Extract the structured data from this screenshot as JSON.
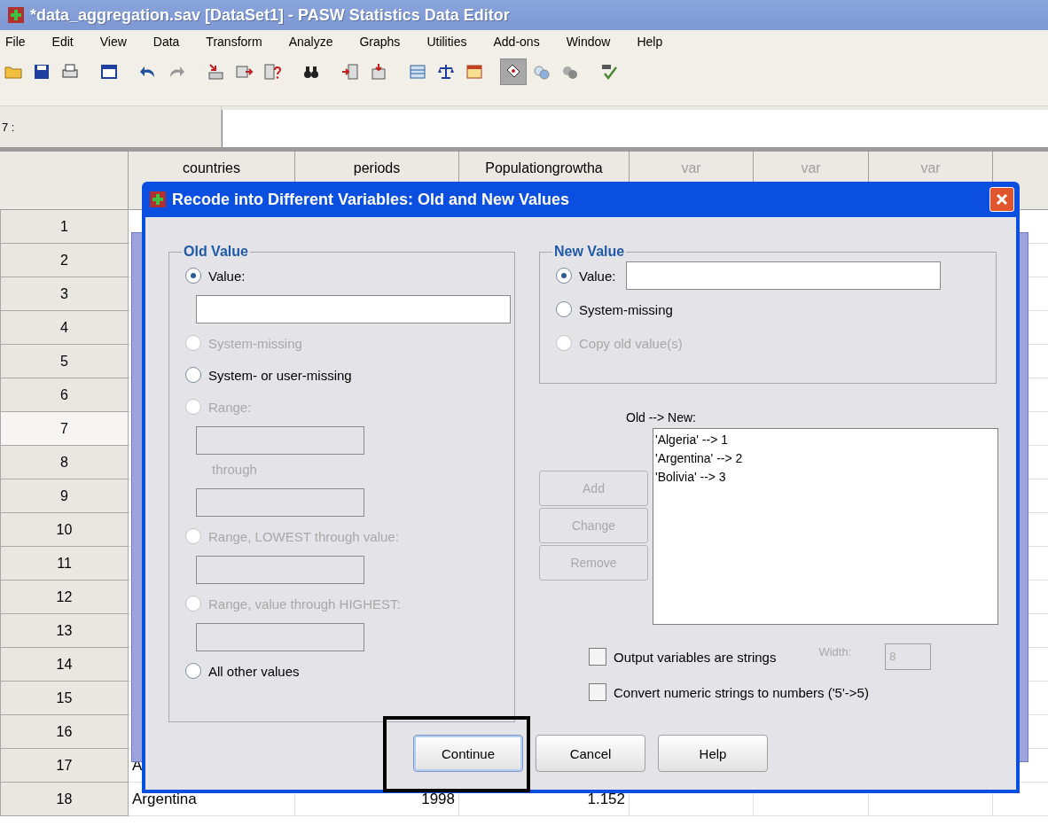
{
  "window": {
    "title": "*data_aggregation.sav [DataSet1] - PASW Statistics Data Editor"
  },
  "menu": [
    "File",
    "Edit",
    "View",
    "Data",
    "Transform",
    "Analyze",
    "Graphs",
    "Utilities",
    "Add-ons",
    "Window",
    "Help"
  ],
  "toolbar": [
    [
      {
        "pressed": false
      },
      {
        "pressed": false
      },
      {
        "pressed": false
      }
    ],
    [
      {
        "pressed": false
      }
    ],
    [
      {
        "pressed": false
      },
      {
        "pressed": false
      }
    ],
    [
      {
        "pressed": false
      },
      {
        "pressed": false
      },
      {
        "pressed": false
      }
    ],
    [
      {
        "pressed": false
      }
    ],
    [
      {
        "pressed": false
      },
      {
        "pressed": false
      }
    ],
    [
      {
        "pressed": false
      },
      {
        "pressed": false
      },
      {
        "pressed": false
      }
    ],
    [
      {
        "pressed": true
      },
      {
        "pressed": false
      },
      {
        "pressed": false
      }
    ],
    [
      {
        "pressed": false
      }
    ]
  ],
  "cell_editor": {
    "reference": "7 :"
  },
  "grid": {
    "columns": [
      {
        "name": "countries",
        "kind": "variable"
      },
      {
        "name": "periods",
        "kind": "variable"
      },
      {
        "name": "Populationgrowtha",
        "kind": "variable"
      },
      {
        "name": "var",
        "kind": "empty"
      },
      {
        "name": "var",
        "kind": "empty"
      },
      {
        "name": "var",
        "kind": "empty"
      }
    ],
    "rows": [
      {
        "number": "1",
        "cells": []
      },
      {
        "number": "2",
        "cells": []
      },
      {
        "number": "3",
        "cells": []
      },
      {
        "number": "4",
        "cells": []
      },
      {
        "number": "5",
        "cells": []
      },
      {
        "number": "6",
        "cells": []
      },
      {
        "number": "7",
        "cells": [],
        "selected": true
      },
      {
        "number": "8",
        "cells": []
      },
      {
        "number": "9",
        "cells": []
      },
      {
        "number": "10",
        "cells": []
      },
      {
        "number": "11",
        "cells": []
      },
      {
        "number": "12",
        "cells": []
      },
      {
        "number": "13",
        "cells": []
      },
      {
        "number": "14",
        "cells": []
      },
      {
        "number": "15",
        "cells": []
      },
      {
        "number": "16",
        "cells": []
      },
      {
        "number": "17",
        "cells": [
          "A"
        ]
      },
      {
        "number": "18",
        "cells": [
          "Argentina",
          "1998",
          "1.152"
        ]
      }
    ]
  },
  "dialog": {
    "title": "Recode into Different Variables: Old and New Values",
    "old_value": {
      "title": "Old Value",
      "items": [
        {
          "kind": "radio",
          "label": "Value:",
          "selected": true,
          "disabled": false
        },
        {
          "kind": "field",
          "disabled": false
        },
        {
          "kind": "radio",
          "label": "System-missing",
          "selected": false,
          "disabled": true
        },
        {
          "kind": "radio",
          "label": "System- or user-missing",
          "selected": false,
          "disabled": false
        },
        {
          "kind": "radio",
          "label": "Range:",
          "selected": false,
          "disabled": true
        },
        {
          "kind": "field",
          "disabled": true
        },
        {
          "kind": "text",
          "label": "through",
          "disabled": true
        },
        {
          "kind": "field",
          "disabled": true
        },
        {
          "kind": "radio",
          "label": "Range, LOWEST through value:",
          "selected": false,
          "disabled": true
        },
        {
          "kind": "field",
          "disabled": true
        },
        {
          "kind": "radio",
          "label": "Range, value through HIGHEST:",
          "selected": false,
          "disabled": true
        },
        {
          "kind": "field",
          "disabled": true
        },
        {
          "kind": "radio",
          "label": "All other values",
          "selected": false,
          "disabled": false
        }
      ]
    },
    "new_value": {
      "title": "New Value",
      "items": [
        {
          "label": "Value:",
          "selected": true,
          "disabled": false,
          "field": true
        },
        {
          "label": "System-missing",
          "selected": false,
          "disabled": false
        },
        {
          "label": "Copy old value(s)",
          "selected": false,
          "disabled": true
        }
      ]
    },
    "list_label": "Old --> New:",
    "list": [
      "'Algeria' --> 1",
      "'Argentina' --> 2",
      "'Bolivia' --> 3"
    ],
    "list_buttons": [
      {
        "label": "Add",
        "disabled": true
      },
      {
        "label": "Change",
        "disabled": true
      },
      {
        "label": "Remove",
        "disabled": true
      }
    ],
    "options": [
      {
        "label": "Output variables are strings",
        "checked": false
      },
      {
        "label": "Convert numeric strings to numbers ('5'->5)",
        "checked": false
      }
    ],
    "width": {
      "label": "Width:",
      "value": "8",
      "disabled": true
    },
    "buttons": [
      {
        "label": "Continue",
        "focused": true
      },
      {
        "label": "Cancel",
        "focused": false
      },
      {
        "label": "Help",
        "focused": false
      }
    ]
  }
}
